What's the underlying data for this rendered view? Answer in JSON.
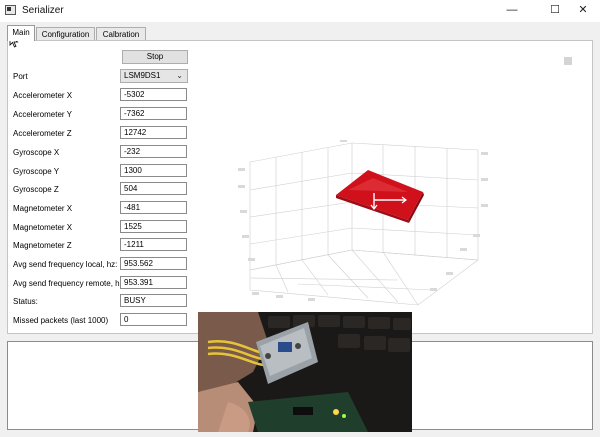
{
  "window": {
    "title": "Serializer",
    "minimize": "—",
    "maximize": "☐",
    "close": "✕"
  },
  "tabs": [
    {
      "label": "Main"
    },
    {
      "label": "Configuration"
    },
    {
      "label": "Calbration"
    }
  ],
  "main": {
    "stop_button": "Stop",
    "port": {
      "label": "Port",
      "value": "LSM9DS1",
      "chevron": "⌄"
    },
    "fields": [
      {
        "label": "Accelerometer X",
        "value": "-5302"
      },
      {
        "label": "Accelerometer Y",
        "value": "-7362"
      },
      {
        "label": "Accelerometer Z",
        "value": "12742"
      },
      {
        "label": "Gyroscope X",
        "value": "-232"
      },
      {
        "label": "Gyroscope Y",
        "value": "1300"
      },
      {
        "label": "Gyroscope Z",
        "value": "504"
      },
      {
        "label": "Magnetometer X",
        "value": "-481"
      },
      {
        "label": "Magnetometer X",
        "value": "1525"
      },
      {
        "label": "Magnetometer Z",
        "value": "-1211"
      },
      {
        "label": "Avg send frequency local, hz:",
        "value": "953.562"
      },
      {
        "label": "Avg send frequency remote, hz:",
        "value": "953.391"
      },
      {
        "label": "Status:",
        "value": "BUSY"
      },
      {
        "label": "Missed packets (last 1000)",
        "value": "0"
      }
    ]
  },
  "visualization": {
    "accent_color": "#d0111b",
    "arrow_color": "#ffffff",
    "grid_color": "#c8c8c8"
  },
  "icons": {
    "app": "app-icon",
    "cursor": "mouse-cursor-icon"
  },
  "colors": {
    "window_bg": "#f0f0f0",
    "panel_bg": "#ffffff",
    "border": "#c4c4c4"
  }
}
